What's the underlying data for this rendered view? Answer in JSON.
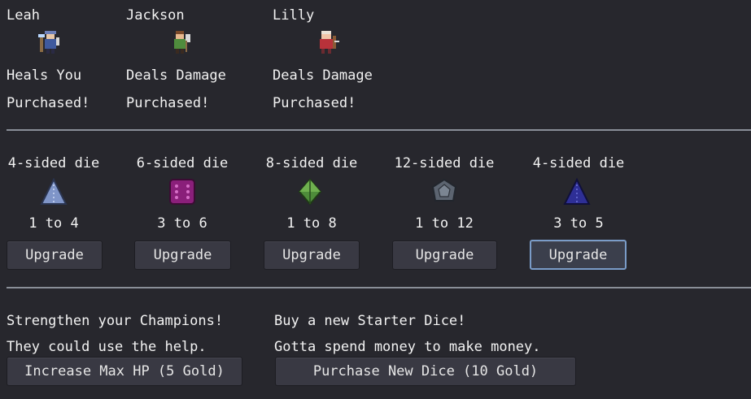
{
  "champions": [
    {
      "name": "Leah",
      "icon": "leah-sprite-icon",
      "ability": "Heals You",
      "status": "Purchased!"
    },
    {
      "name": "Jackson",
      "icon": "jackson-sprite-icon",
      "ability": "Deals Damage",
      "status": "Purchased!"
    },
    {
      "name": "Lilly",
      "icon": "lilly-sprite-icon",
      "ability": "Deals Damage",
      "status": "Purchased!"
    }
  ],
  "dice": [
    {
      "name": "4-sided die",
      "icon": "d4-icon",
      "range": "1 to 4",
      "button": "Upgrade",
      "color": "#7f95c8"
    },
    {
      "name": "6-sided die",
      "icon": "d6-icon",
      "range": "3 to 6",
      "button": "Upgrade",
      "color": "#8a1f7a"
    },
    {
      "name": "8-sided die",
      "icon": "d8-icon",
      "range": "1 to 8",
      "button": "Upgrade",
      "color": "#4e8c3a"
    },
    {
      "name": "12-sided die",
      "icon": "d12-icon",
      "range": "1 to 12",
      "button": "Upgrade",
      "color": "#5c6470"
    },
    {
      "name": "4-sided die",
      "icon": "d4-icon",
      "range": "3 to 5",
      "button": "Upgrade",
      "color": "#2e2f96"
    }
  ],
  "shop": {
    "hp": {
      "line1": "Strengthen your Champions!",
      "line2": "They could use the help.",
      "button": "Increase Max HP (5 Gold)"
    },
    "dice": {
      "line1": "Buy a new Starter Dice!",
      "line2": "Gotta spend money to make money.",
      "button": "Purchase New Dice (10 Gold)"
    }
  }
}
